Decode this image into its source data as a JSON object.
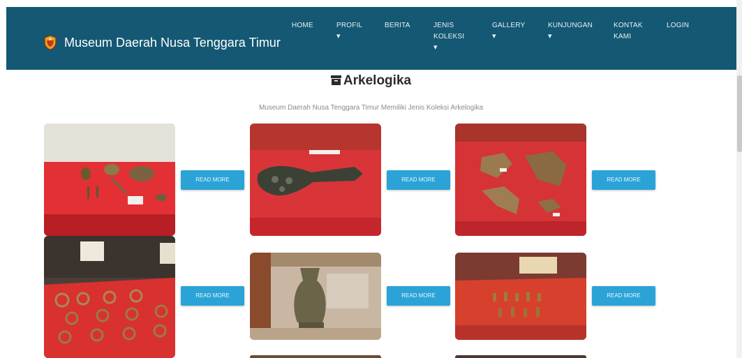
{
  "header": {
    "title": "Museum Daerah Nusa Tenggara Timur",
    "logo_icon": "museum-logo-icon",
    "background": "#145873"
  },
  "nav": {
    "home": "HOME",
    "profil": "PROFIL",
    "berita": "BERITA",
    "jenis_koleksi_line1": "JENIS",
    "jenis_koleksi_line2": "KOLEKSI",
    "gallery": "GALLERY",
    "kunjungan": "KUNJUNGAN",
    "kontak_line1": "KONTAK",
    "kontak_line2": "KAMI",
    "login": "LOGIN",
    "caret": "▾"
  },
  "page": {
    "title": "Arkelogika",
    "title_icon": "archive-box-icon",
    "subtitle": "Museum Daerah Nusa Tenggara Timur Memiliki Jenis Koleksi Arkelogika"
  },
  "collection": {
    "read_more": "READ MORE",
    "button_color": "#2ba3d7",
    "items": [
      {
        "subject": "bronze-objects-display"
      },
      {
        "subject": "bronze-ceremonial-axe"
      },
      {
        "subject": "bronze-axe-fragments"
      },
      {
        "subject": "bronze-bracelets-display"
      },
      {
        "subject": "bronze-vessel"
      },
      {
        "subject": "small-bronze-artifacts"
      }
    ]
  }
}
